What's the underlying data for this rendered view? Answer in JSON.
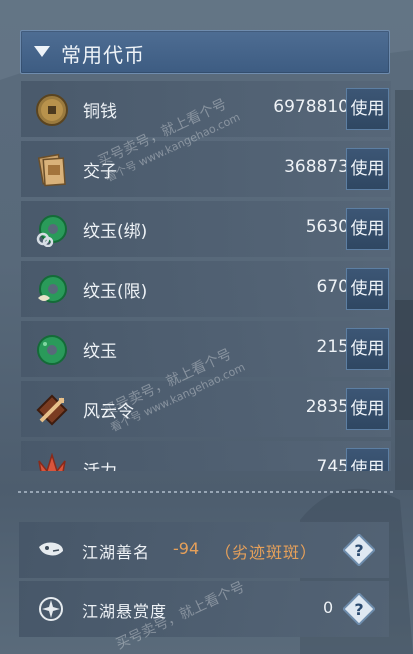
{
  "header": {
    "title": "常用代币"
  },
  "currencies": [
    {
      "name": "铜钱",
      "value": "6978810",
      "action": "使用",
      "icon": "copper-coin-icon"
    },
    {
      "name": "交子",
      "value": "368873",
      "action": "使用",
      "icon": "banknote-icon"
    },
    {
      "name": "纹玉(绑)",
      "value": "5630",
      "action": "使用",
      "icon": "jade-bound-icon"
    },
    {
      "name": "纹玉(限)",
      "value": "670",
      "action": "使用",
      "icon": "jade-limited-icon"
    },
    {
      "name": "纹玉",
      "value": "215",
      "action": "使用",
      "icon": "jade-icon"
    },
    {
      "name": "风云令",
      "value": "2835",
      "action": "使用",
      "icon": "fengyun-token-icon"
    },
    {
      "name": "活力",
      "value": "745",
      "action": "使用",
      "icon": "vitality-icon"
    }
  ],
  "reputation": [
    {
      "name": "江湖善名",
      "value": "-94",
      "status": "（劣迹斑斑）",
      "value_color": "#e6a05a",
      "icon": "mask-icon",
      "help_icon": "question-diamond-icon"
    },
    {
      "name": "江湖悬赏度",
      "value": "0",
      "value_color": "#eef2f6",
      "icon": "bounty-icon",
      "help_icon": "question-diamond-icon"
    }
  ],
  "watermark": {
    "main": "买号卖号，就上看个号",
    "url": "www.kangehao.com",
    "brand": "看个号"
  },
  "colors": {
    "header_bg": "#46658b",
    "button_bg": "#35506d",
    "accent_negative": "#e6a05a"
  }
}
